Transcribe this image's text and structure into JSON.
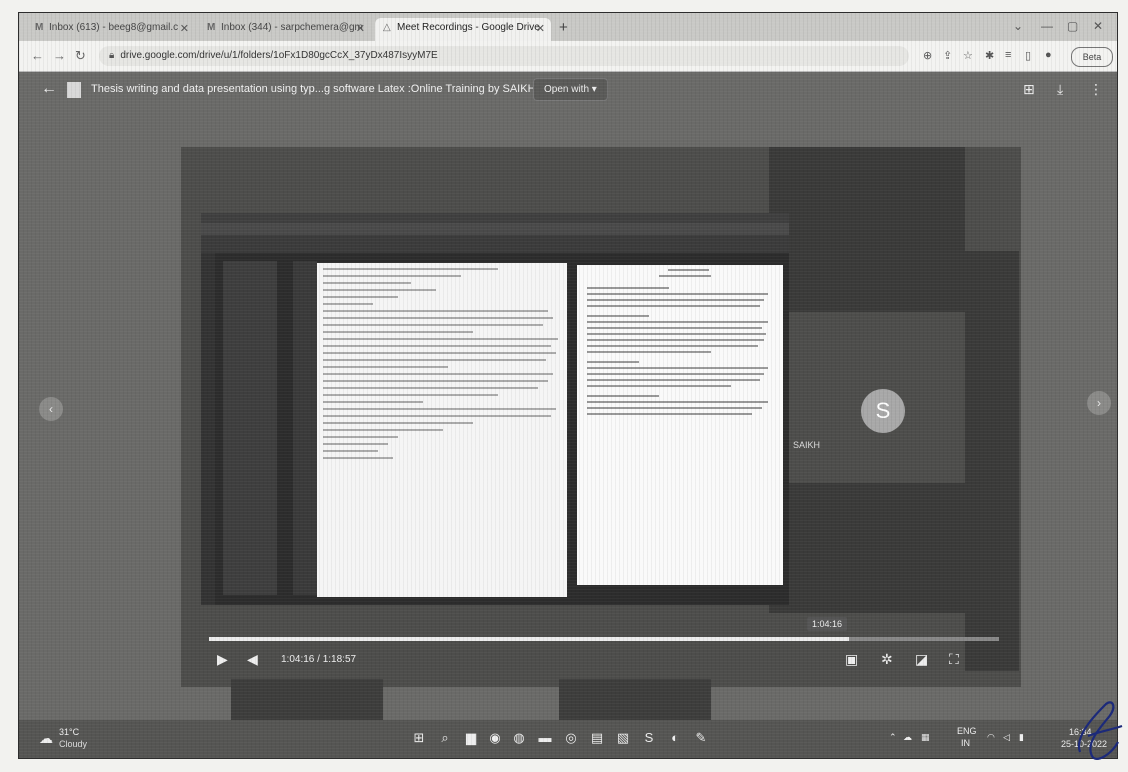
{
  "browser": {
    "tabs": [
      {
        "label": "Inbox (613) - beeg8@gmail.c",
        "icon": "gmail-icon"
      },
      {
        "label": "Inbox (344) - sarpchemera@gm",
        "icon": "gmail-icon"
      },
      {
        "label": "Meet Recordings - Google Drive",
        "icon": "drive-icon",
        "active": true
      }
    ],
    "url": "drive.google.com/drive/u/1/folders/1oFx1D80gcCcX_37yDx487IsyyM7E",
    "profile_label": "Beta"
  },
  "viewer": {
    "file_title": "Thesis writing and data presentation using typ...g software Latex :Online Training by SAIKH CR",
    "open_with": "Open with"
  },
  "video": {
    "speaker_initial": "S",
    "speaker_name": "SAIKH",
    "hover_time": "1:04:16",
    "time_readout": "1:04:16 / 1:18:57",
    "progress_fraction": 0.81
  },
  "taskbar": {
    "temperature": "31°C",
    "weather": "Cloudy",
    "language_line1": "ENG",
    "language_line2": "IN",
    "time": "16:34",
    "date": "25-10-2022"
  }
}
